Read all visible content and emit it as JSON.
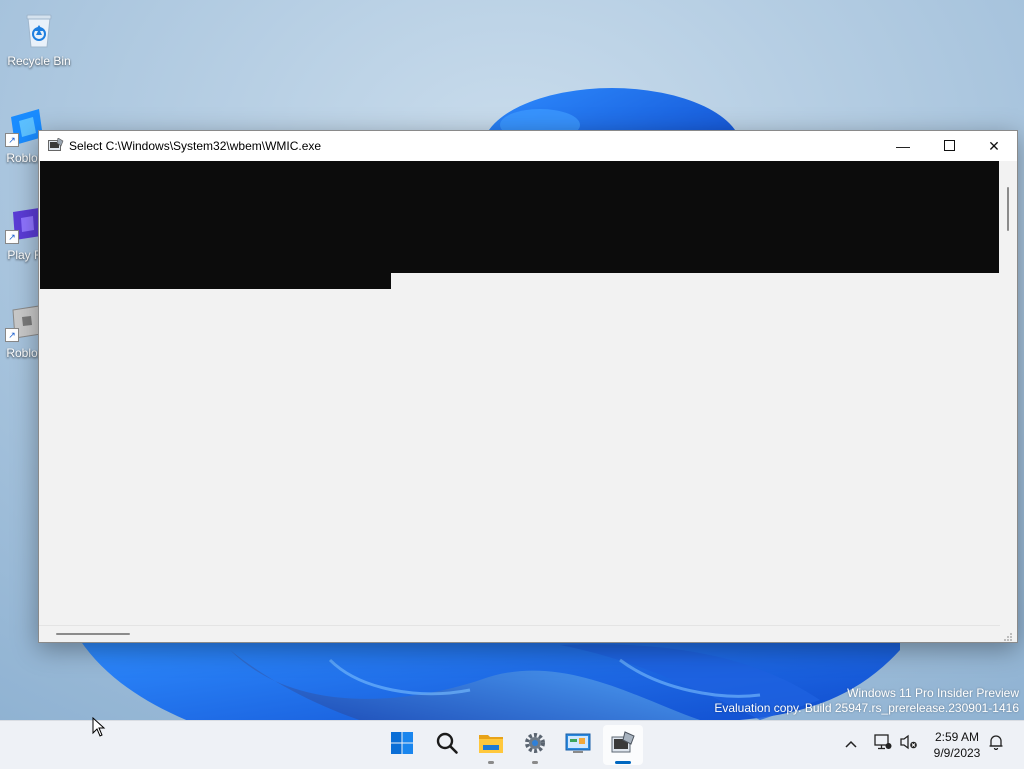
{
  "desktop": {
    "icons": [
      {
        "label": "Recycle Bin",
        "icon": "recycle-bin-icon"
      },
      {
        "label": "Roblox",
        "icon": "roblox-studio-icon"
      },
      {
        "label": "Play R",
        "icon": "play-roblox-icon"
      },
      {
        "label": "Roblox",
        "icon": "roblox-player-icon"
      }
    ]
  },
  "window": {
    "title": "Select C:\\Windows\\System32\\wbem\\WMIC.exe",
    "minimize_glyph": "—",
    "maximize_glyph": "☐",
    "close_glyph": "✕",
    "console_bg": "#0c0c0c",
    "window_bg": "#f2f2f2"
  },
  "watermark": {
    "line1": "Windows 11 Pro Insider Preview",
    "line2": "Evaluation copy. Build 25947.rs_prerelease.230901-1416"
  },
  "taskbar": {
    "apps": [
      {
        "name": "start-button",
        "icon": "windows-logo-icon"
      },
      {
        "name": "search-button",
        "icon": "search-icon"
      },
      {
        "name": "file-explorer",
        "icon": "folder-icon"
      },
      {
        "name": "settings",
        "icon": "gear-icon"
      },
      {
        "name": "control-panel",
        "icon": "control-panel-icon"
      },
      {
        "name": "wmic",
        "icon": "wmic-console-icon",
        "active": true
      }
    ],
    "tray": {
      "overflow_icon": "chevron-up-icon",
      "network_icon": "network-disconnected-icon",
      "volume_icon": "volume-muted-icon",
      "notification_icon": "bell-icon"
    },
    "clock": {
      "time": "2:59 AM",
      "date": "9/9/2023"
    }
  },
  "colors": {
    "accent": "#0067c0",
    "taskbar_bg": "#eef1f6"
  }
}
